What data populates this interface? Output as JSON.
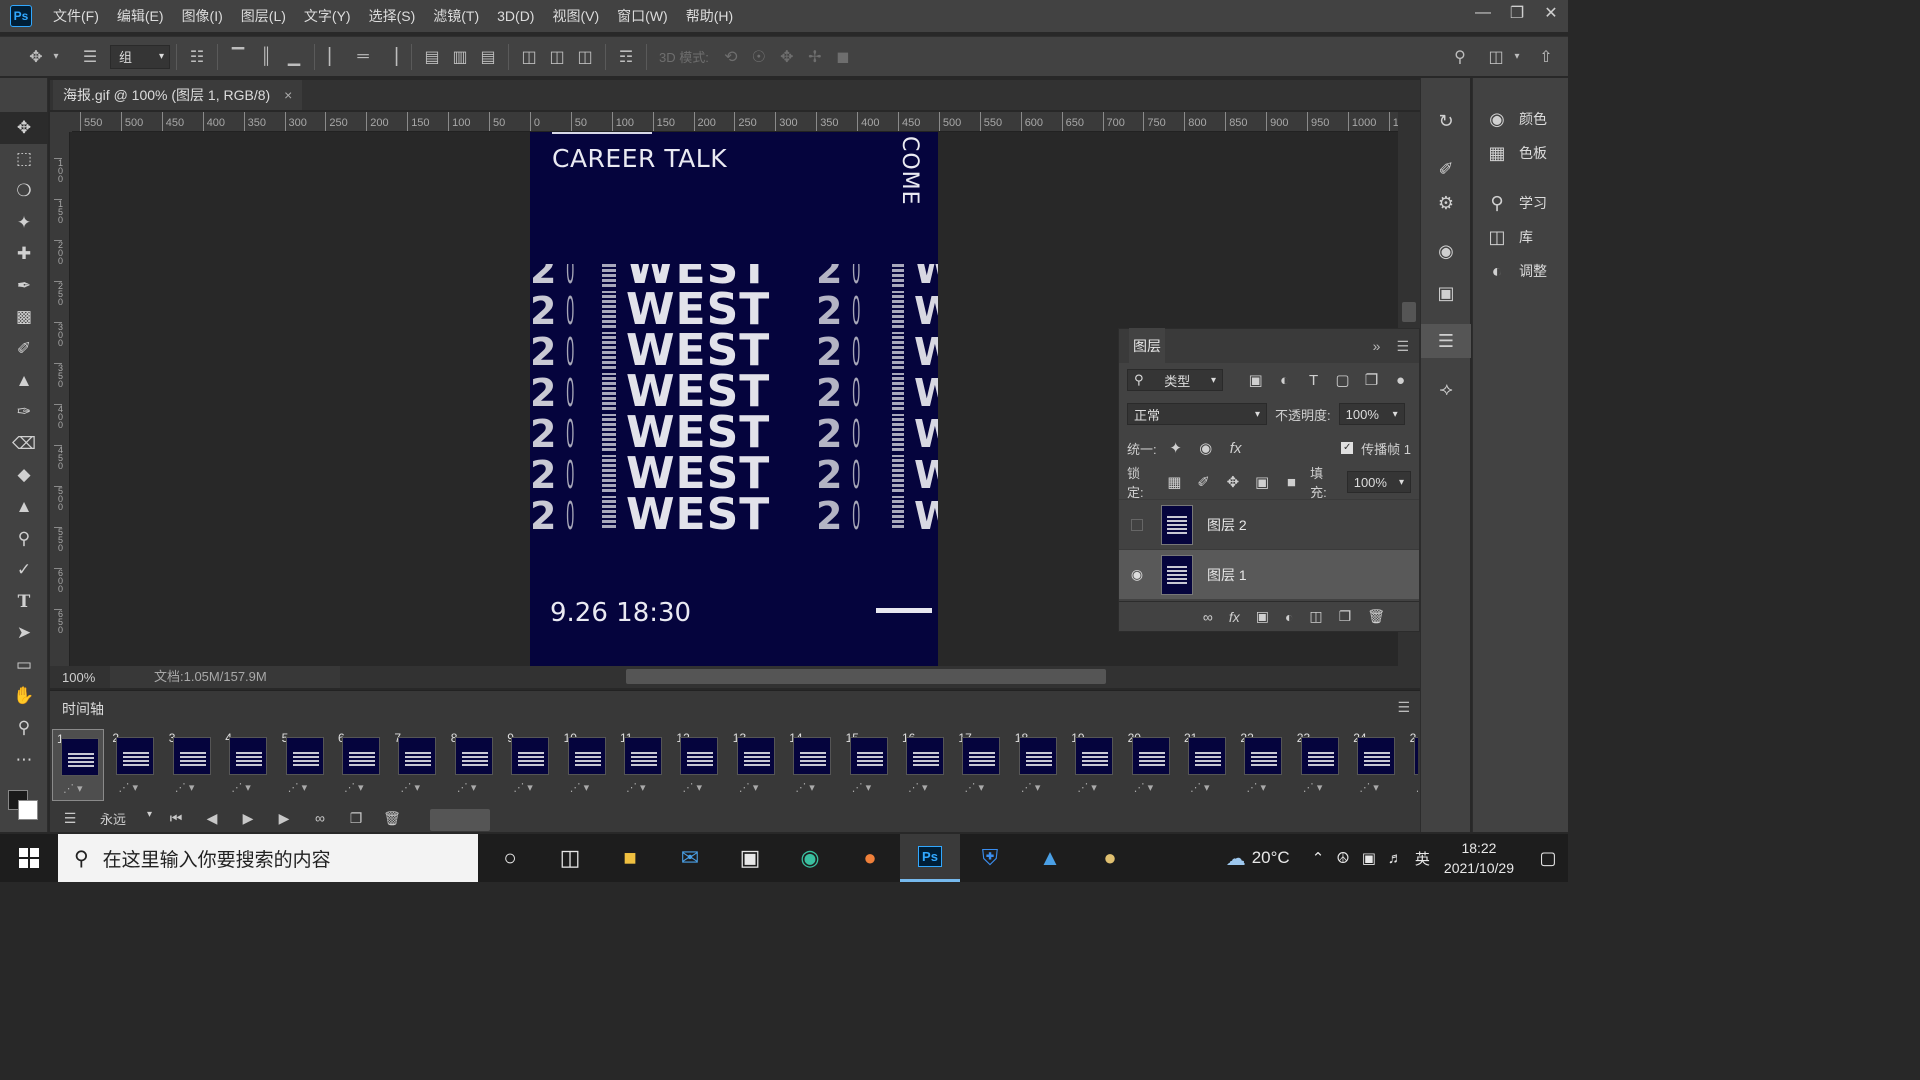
{
  "app": {
    "logo": "Ps"
  },
  "menu": [
    "文件(F)",
    "编辑(E)",
    "图像(I)",
    "图层(L)",
    "文字(Y)",
    "选择(S)",
    "滤镜(T)",
    "3D(D)",
    "视图(V)",
    "窗口(W)",
    "帮助(H)"
  ],
  "options": {
    "auto_select_value": "组",
    "mode_3d_label": "3D 模式:"
  },
  "document": {
    "tab_title": "海报.gif @ 100% (图层 1, RGB/8)",
    "close_glyph": "×"
  },
  "ruler_h": [
    "550",
    "500",
    "450",
    "400",
    "350",
    "300",
    "250",
    "200",
    "150",
    "100",
    "50",
    "0",
    "50",
    "100",
    "150",
    "200",
    "250",
    "300",
    "350",
    "400",
    "450",
    "500",
    "550",
    "600",
    "650",
    "700",
    "750",
    "800",
    "850",
    "900",
    "950",
    "1000",
    "1"
  ],
  "ruler_v": [
    "1 0 0",
    "1 5 0",
    "2 0 0",
    "2 5 0",
    "3 0 0",
    "3 5 0",
    "4 0 0",
    "4 5 0",
    "5 0 0",
    "5 5 0",
    "6 0 0",
    "6 5 0"
  ],
  "poster": {
    "title": "CAREER TALK",
    "vertical_text": "COME",
    "repeat_word": "WEST",
    "repeat_digit": "2",
    "repeat_digit_b": "0",
    "edge_letter": "W",
    "date": "9.26 18:30",
    "background_color": "#05043d"
  },
  "status": {
    "zoom": "100%",
    "doc_info": "文档:1.05M/157.9M"
  },
  "timeline": {
    "title": "时间轴",
    "loop": "永远",
    "frames": [
      "1",
      "2",
      "3",
      "4",
      "5",
      "6",
      "7",
      "8",
      "9",
      "10",
      "11",
      "12",
      "13",
      "14",
      "15",
      "16",
      "17",
      "18",
      "19",
      "20",
      "21",
      "22",
      "23",
      "24",
      "2"
    ],
    "selected_frame": "1"
  },
  "dock": {
    "panels": [
      {
        "icon": "palette-icon",
        "label": "颜色"
      },
      {
        "icon": "grid-icon",
        "label": "色板"
      },
      {
        "icon": "bulb-icon",
        "label": "学习"
      },
      {
        "icon": "library-icon",
        "label": "库"
      },
      {
        "icon": "adjust-icon",
        "label": "调整"
      }
    ]
  },
  "layers": {
    "tab": "图层",
    "filter_kind": "类型",
    "blend_mode": "正常",
    "opacity_label": "不透明度:",
    "opacity": "100%",
    "unify_label": "统一:",
    "propagate_label": "传播帧 1",
    "lock_label": "锁定:",
    "fill_label": "填充:",
    "fill": "100%",
    "items": [
      {
        "name": "图层 2",
        "visible": false
      },
      {
        "name": "图层 1",
        "visible": true,
        "selected": true
      }
    ]
  },
  "taskbar": {
    "search_placeholder": "在这里输入你要搜索的内容",
    "weather": "20°C",
    "ime": "英",
    "time": "18:22",
    "date": "2021/10/29",
    "active_app": "Ps"
  }
}
